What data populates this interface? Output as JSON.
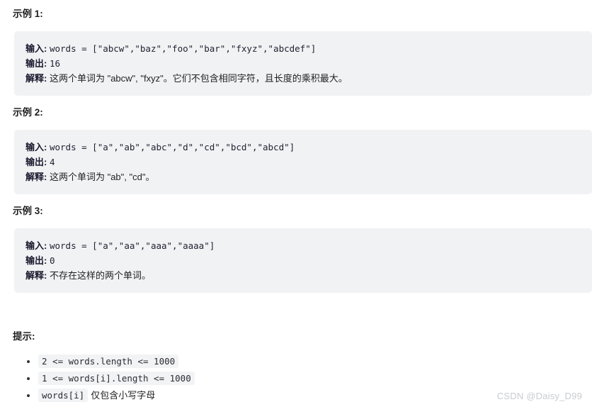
{
  "colors": {
    "block_background": "#f1f2f4",
    "inline_code_background": "#f2f3f5",
    "text": "#1f1f1f",
    "watermark": "#c9cbd0"
  },
  "examples": [
    {
      "heading": "示例 1:",
      "input_label": "输入:",
      "input_value": "words = [\"abcw\",\"baz\",\"foo\",\"bar\",\"fxyz\",\"abcdef\"]",
      "output_label": "输出:",
      "output_value": "16",
      "explain_label": "解释:",
      "explain_value": "这两个单词为 \"abcw\", \"fxyz\"。它们不包含相同字符，且长度的乘积最大。"
    },
    {
      "heading": "示例 2:",
      "input_label": "输入:",
      "input_value": "words = [\"a\",\"ab\",\"abc\",\"d\",\"cd\",\"bcd\",\"abcd\"]",
      "output_label": "输出:",
      "output_value": "4",
      "explain_label": "解释:",
      "explain_value": "这两个单词为 \"ab\", \"cd\"。"
    },
    {
      "heading": "示例 3:",
      "input_label": "输入:",
      "input_value": "words = [\"a\",\"aa\",\"aaa\",\"aaaa\"]",
      "output_label": "输出:",
      "output_value": "0",
      "explain_label": "解释:",
      "explain_value": "不存在这样的两个单词。"
    }
  ],
  "hints": {
    "heading": "提示:",
    "items": [
      {
        "code": "2 <= words.length <= 1000",
        "text": ""
      },
      {
        "code": "1 <= words[i].length <= 1000",
        "text": ""
      },
      {
        "code": "words[i]",
        "text": "仅包含小写字母"
      }
    ]
  },
  "watermark": {
    "text": "CSDN @Daisy_D99"
  }
}
